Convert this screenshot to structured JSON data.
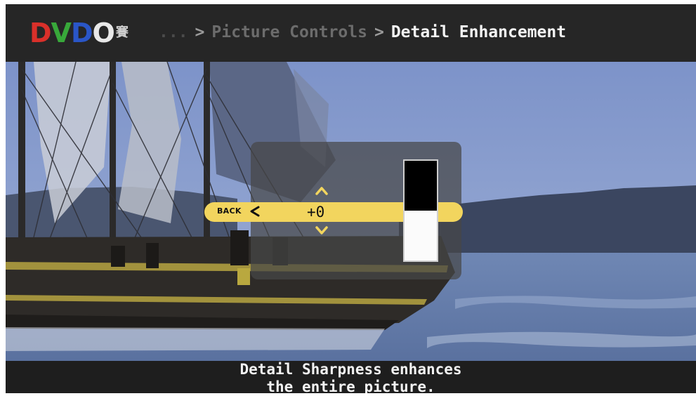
{
  "header": {
    "logo": {
      "letters": [
        "D",
        "V",
        "D",
        "O"
      ],
      "mark": "賽"
    },
    "breadcrumb": {
      "ellipsis": "...",
      "separator": ">",
      "previous": "Picture Controls",
      "current": "Detail Enhancement"
    }
  },
  "osd": {
    "back_label": "BACK",
    "back_arrow_icon": "chevron-left-icon",
    "value": "+0",
    "up_icon": "chevron-up-icon",
    "down_icon": "chevron-down-icon",
    "level_fraction": 0.5
  },
  "caption": {
    "line1": "Detail Sharpness enhances",
    "line2": "the entire picture."
  },
  "colors": {
    "accent": "#f2d55e",
    "logo_d": "#d9302a",
    "logo_v": "#38a83a",
    "logo_d2": "#2a56c7",
    "logo_o": "#e8e8e8"
  }
}
